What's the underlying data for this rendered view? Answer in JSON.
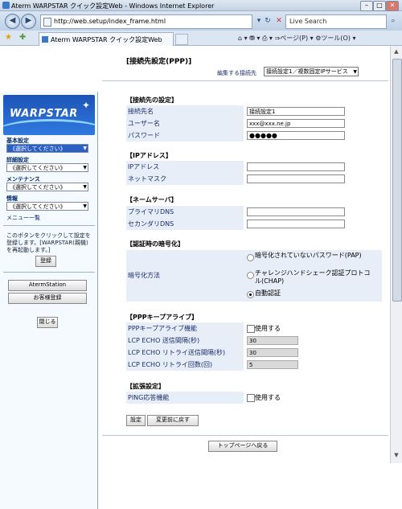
{
  "window": {
    "title": "Aterm WARPSTAR クイック設定Web - Windows Internet Explorer",
    "min": "–",
    "max": "□",
    "close": "✕"
  },
  "nav": {
    "back_icon": "◀",
    "forward_icon": "▶",
    "url": "http://web.setup/index_frame.html",
    "refresh": "↻",
    "stop": "✕",
    "search_placeholder": "Live Search"
  },
  "tabs": {
    "active": "Aterm WARPSTAR クイック設定Web",
    "tools": "⌂ ▾  ⛃ ▾  ⎙ ▾  ⇒ページ(P) ▾  ⚙ツール(O) ▾"
  },
  "left": {
    "logo_text": "WARPSTAR",
    "sections": [
      {
        "title": "基本設定",
        "value": "《選択してください》",
        "highlight": true
      },
      {
        "title": "詳細設定",
        "value": "《選択してください》",
        "highlight": false
      },
      {
        "title": "メンテナンス",
        "value": "《選択してください》",
        "highlight": false
      },
      {
        "title": "情報",
        "value": "《選択してください》",
        "highlight": false
      }
    ],
    "menu_list": "メニュー一覧",
    "note": "このボタンをクリックして設定を登録します。[WARPSTAR(親機)を再起動します。]",
    "register": "登録",
    "aterm_station": "AtermStation",
    "customer_register": "お客様登録",
    "close": "閉じる"
  },
  "main": {
    "page_title": "[接続先設定(PPP)]",
    "editing_label": "編集する接続先",
    "editing_value": "接続設定1／複数固定IPサービス",
    "sec_conn": "【接続先の設定】",
    "conn_name_label": "接続先名",
    "conn_name_value": "接続設定1",
    "user_label": "ユーザー名",
    "user_value": "xxx@xxx.ne.jp",
    "pass_label": "パスワード",
    "pass_value": "●●●●●",
    "sec_ip": "【IPアドレス】",
    "ip_label": "IPアドレス",
    "mask_label": "ネットマスク",
    "sec_dns": "【ネームサーバ】",
    "dns1_label": "プライマリDNS",
    "dns2_label": "セカンダリDNS",
    "sec_auth": "【認証時の暗号化】",
    "auth_label": "暗号化方法",
    "auth_opt1": "暗号化されていないパスワード(PAP)",
    "auth_opt2": "チャレンジハンドシェーク認証プロトコル(CHAP)",
    "auth_opt3": "自動認証",
    "auth_selected": 3,
    "sec_keep": "【PPPキープアライブ】",
    "keep_func_label": "PPPキープアライブ機能",
    "keep_func_chk": "使用する",
    "lcp_interval_label": "LCP ECHO 送信間隔(秒)",
    "lcp_interval_value": "30",
    "lcp_retry_interval_label": "LCP ECHO リトライ送信間隔(秒)",
    "lcp_retry_interval_value": "30",
    "lcp_retry_count_label": "LCP ECHO リトライ回数(回)",
    "lcp_retry_count_value": "5",
    "sec_ext": "【拡張設定】",
    "ping_label": "PING応答機能",
    "ping_chk": "使用する",
    "set_button": "設定",
    "revert_button": "変更前に戻す",
    "top_button": "トップページへ戻る"
  }
}
